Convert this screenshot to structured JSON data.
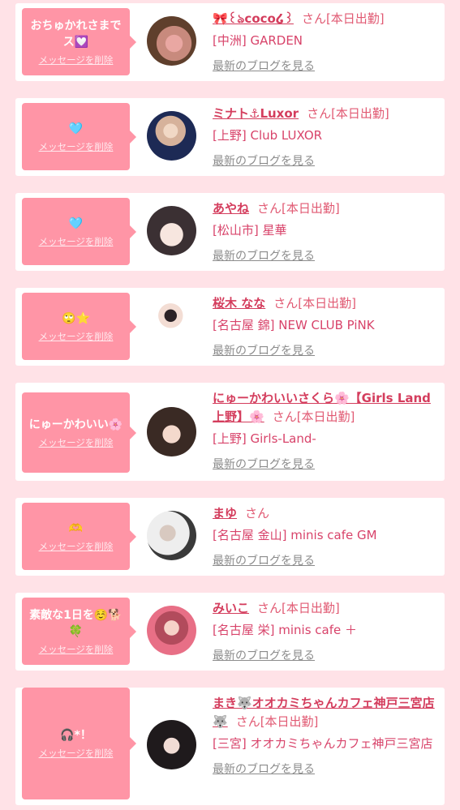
{
  "delete_label": "メッセージを削除",
  "blog_label": "最新のブログを見る",
  "san": "さん",
  "items": [
    {
      "message": "おちゅかれさまでス💟",
      "name": "🎀꒰ঌcoco໒꒱",
      "status": "[本日出勤]",
      "shop": "[中洲] GARDEN"
    },
    {
      "message": "🩵",
      "name": "ミナト⚓Luxor",
      "status": "[本日出勤]",
      "shop": "[上野] Club LUXOR"
    },
    {
      "message": "🩵",
      "name": "あやね",
      "status": "[本日出勤]",
      "shop": "[松山市] 星華"
    },
    {
      "message": "🙄⭐",
      "name": "桜木 なな",
      "status": "[本日出勤]",
      "shop": "[名古屋 錦] NEW CLUB PiNK"
    },
    {
      "message": "にゅーかわいい🌸",
      "name": "にゅーかわいいさくら🌸【Girls Land上野】🌸",
      "status": "[本日出勤]",
      "shop": "[上野] Girls-Land-"
    },
    {
      "message": "🫶",
      "name": "まゆ",
      "status": "",
      "shop": "[名古屋 金山] minis cafe GM"
    },
    {
      "message": "素敵な1日を☺️🐕🍀",
      "name": "みいこ",
      "status": "[本日出勤]",
      "shop": "[名古屋 栄] minis cafe ＋"
    },
    {
      "message": "🎧*！",
      "name": "まき🐺オオカミちゃんカフェ神戸三宮店🐺",
      "status": "[本日出勤]",
      "shop": "[三宮] オオカミちゃんカフェ神戸三宮店"
    }
  ],
  "colors": {
    "background": "#ffe2e7",
    "bubble": "#ff95a6",
    "name": "#d43d5d",
    "shop": "#d8436a",
    "blog": "#8c8c8c"
  }
}
